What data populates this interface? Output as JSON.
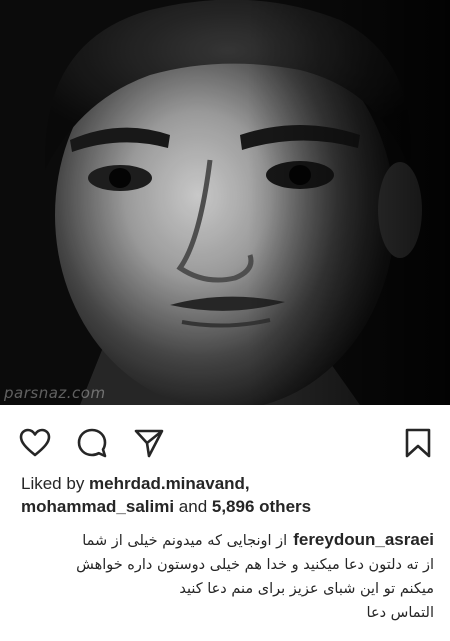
{
  "post": {
    "image": {
      "description_icon": "portrait-photo",
      "watermark": "parsnaz.com"
    },
    "actions": {
      "like_icon": "heart-icon",
      "comment_icon": "comment-bubble-icon",
      "share_icon": "send-paper-plane-icon",
      "save_icon": "bookmark-icon"
    },
    "likes": {
      "prefix": "Liked by ",
      "user1": "mehrdad.minavand",
      "separator": ",",
      "user2": "mohammad_salimi",
      "middle": " and ",
      "others": "5,896 others"
    },
    "caption": {
      "username": "fereydoun_asraei",
      "line1": "از اونجایی که میدونم خیلی از شما",
      "line2": "از ته دلتون دعا میکنید و خدا هم خیلی دوستون داره خواهش",
      "line3": "میکنم تو این شبای عزیز برای منم دعا کنید",
      "line4": "التماس دعا"
    }
  },
  "colors": {
    "text": "#262626",
    "background": "#ffffff"
  }
}
